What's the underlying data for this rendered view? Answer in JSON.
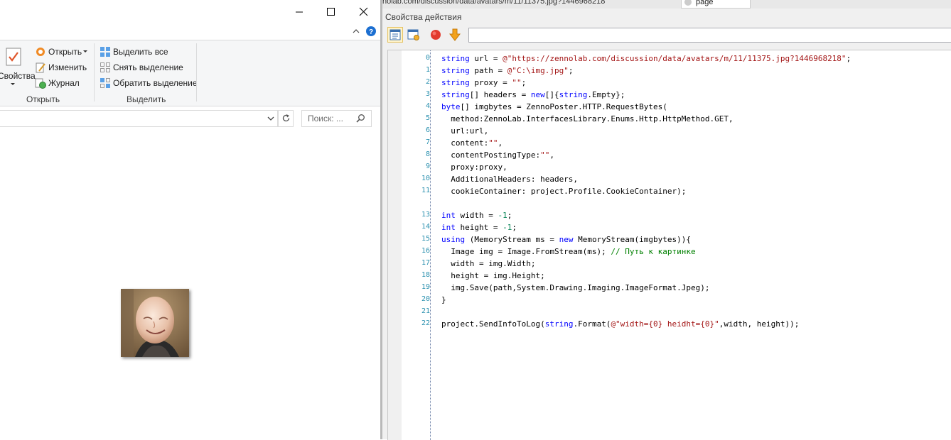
{
  "explorer": {
    "ribbon": {
      "properties_label": "Свойства",
      "open_label": "Открыть",
      "edit_label": "Изменить",
      "history_label": "Журнал",
      "group_open": "Открыть",
      "select_all_label": "Выделить все",
      "select_none_label": "Снять выделение",
      "invert_selection_label": "Обратить выделение",
      "group_select": "Выделить"
    },
    "search_placeholder": "Поиск: ..."
  },
  "props": {
    "url_ghost": "nolab.com/discussion/data/avatars/m/11/11375.jpg?1446968218",
    "page_tab": "page",
    "title": "Свойства действия",
    "toolbar_input": ""
  },
  "code": {
    "line_numbers": [
      "0",
      "1",
      "2",
      "3",
      "4",
      "5",
      "6",
      "7",
      "8",
      "9",
      "10",
      "11",
      "13",
      "14",
      "15",
      "16",
      "17",
      "18",
      "19",
      "20",
      "21",
      "22"
    ]
  },
  "colors": {
    "keyword": "#0000ff",
    "string": "#a31515",
    "number": "#098658",
    "comment": "#008000",
    "line_number": "#2b91af"
  }
}
